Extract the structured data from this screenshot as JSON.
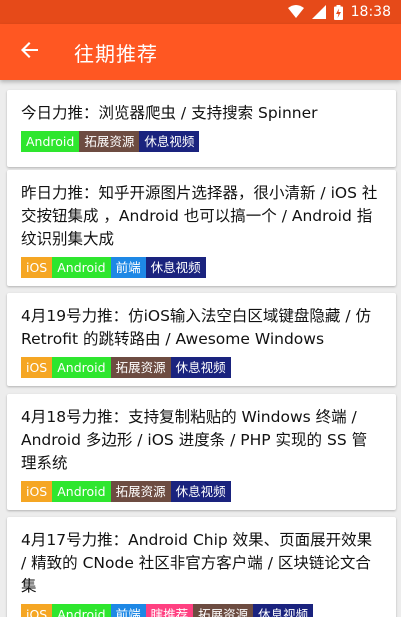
{
  "status_bar": {
    "time": "18:38"
  },
  "app_bar": {
    "title": "往期推荐"
  },
  "tag_colors": {
    "iOS": "#f5a623",
    "Android": "#2ee62e",
    "前端": "#1e88e5",
    "拓展资源": "#6d4c41",
    "休息视频": "#1a237e",
    "瞎推荐": "#ff4081"
  },
  "cards": [
    {
      "title": "今日力推：浏览器爬虫 / 支持搜索 Spinner",
      "tags": [
        "Android",
        "拓展资源",
        "休息视频"
      ]
    },
    {
      "title": "昨日力推：知乎开源图片选择器，很小清新 / iOS 社交按钮集成 ，Android 也可以搞一个 / Android 指纹识别集大成",
      "tags": [
        "iOS",
        "Android",
        "前端",
        "休息视频"
      ]
    },
    {
      "title": "4月19号力推：仿iOS输入法空白区域键盘隐藏 / 仿 Retrofit 的跳转路由 / Awesome Windows",
      "tags": [
        "iOS",
        "Android",
        "拓展资源",
        "休息视频"
      ]
    },
    {
      "title": "4月18号力推：支持复制粘贴的 Windows 终端 / Android 多边形 / iOS 进度条 / PHP 实现的 SS 管理系统",
      "tags": [
        "iOS",
        "Android",
        "拓展资源",
        "休息视频"
      ]
    },
    {
      "title": "4月17号力推：Android Chip 效果、页面展开效果 / 精致的 CNode 社区非官方客户端 / 区块链论文合集",
      "tags": [
        "iOS",
        "Android",
        "前端",
        "瞎推荐",
        "拓展资源",
        "休息视频"
      ]
    }
  ]
}
